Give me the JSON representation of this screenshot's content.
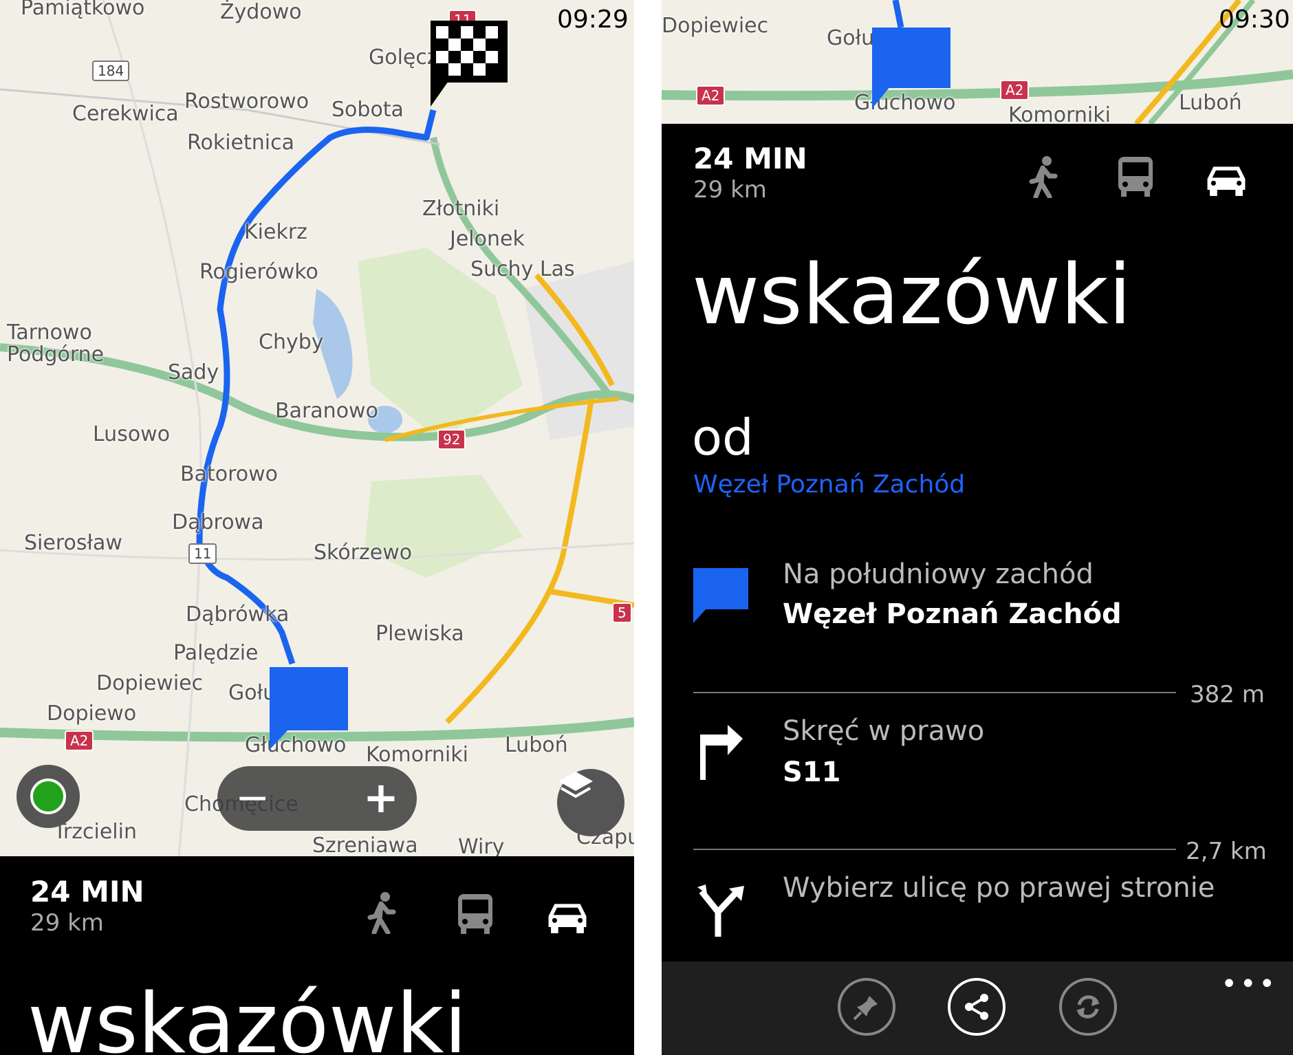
{
  "left": {
    "status_time": "09:29",
    "map_labels": [
      "Pamiątkowo",
      "Żydowo",
      "Golęczewo",
      "Cerekwica",
      "Rostworowo",
      "Sobota",
      "Rokietnica",
      "Złotniki",
      "Kiekrz",
      "Jelonek",
      "Rogierówko",
      "Suchy Las",
      "Chyby",
      "Tarnowo Podgórne",
      "Sady",
      "Baranowo",
      "Lusowo",
      "Batorowo",
      "Dąbrowa",
      "Sierosław",
      "Skórzewo",
      "Dąbrówka",
      "Plewiska",
      "Palędzie",
      "Dopiewiec",
      "Gołuski",
      "Dopiewo",
      "Głuchowo",
      "Komorniki",
      "Luboń",
      "Chomęcice",
      "Trzcielin",
      "Szreniawa",
      "Wiry",
      "Czapury"
    ],
    "road_numbers": [
      "184",
      "92",
      "11",
      "A2",
      "5",
      "11"
    ],
    "panel": {
      "time": "24 MIN",
      "distance": "29 km"
    },
    "title": "wskazówki"
  },
  "right": {
    "status_time": "09:30",
    "map_labels": [
      "Dopiewiec",
      "Gołuski",
      "Głuchowo",
      "Komorniki",
      "Luboń"
    ],
    "road_numbers": [
      "A2",
      "A2"
    ],
    "panel": {
      "time": "24 MIN",
      "distance": "29 km"
    },
    "title": "wskazówki",
    "from_label": "od",
    "from_place": "Węzeł Poznań Zachód",
    "steps": [
      {
        "main": "Na południowy zachód",
        "sub": "Węzeł Poznań Zachód",
        "icon": "start-flag-icon"
      },
      {
        "distance": "382 m",
        "main": "Skręć w prawo",
        "sub": "S11",
        "icon": "turn-right-icon"
      },
      {
        "distance": "2,7 km",
        "main": "Wybierz ulicę po prawej stronie",
        "sub": "",
        "icon": "keep-right-icon"
      }
    ],
    "more": "•••"
  },
  "colors": {
    "accent": "#1e63ff",
    "route": "#1a64f0",
    "highway": "#8fc79a",
    "primary_road": "#f3b81e",
    "background": "#000000"
  }
}
